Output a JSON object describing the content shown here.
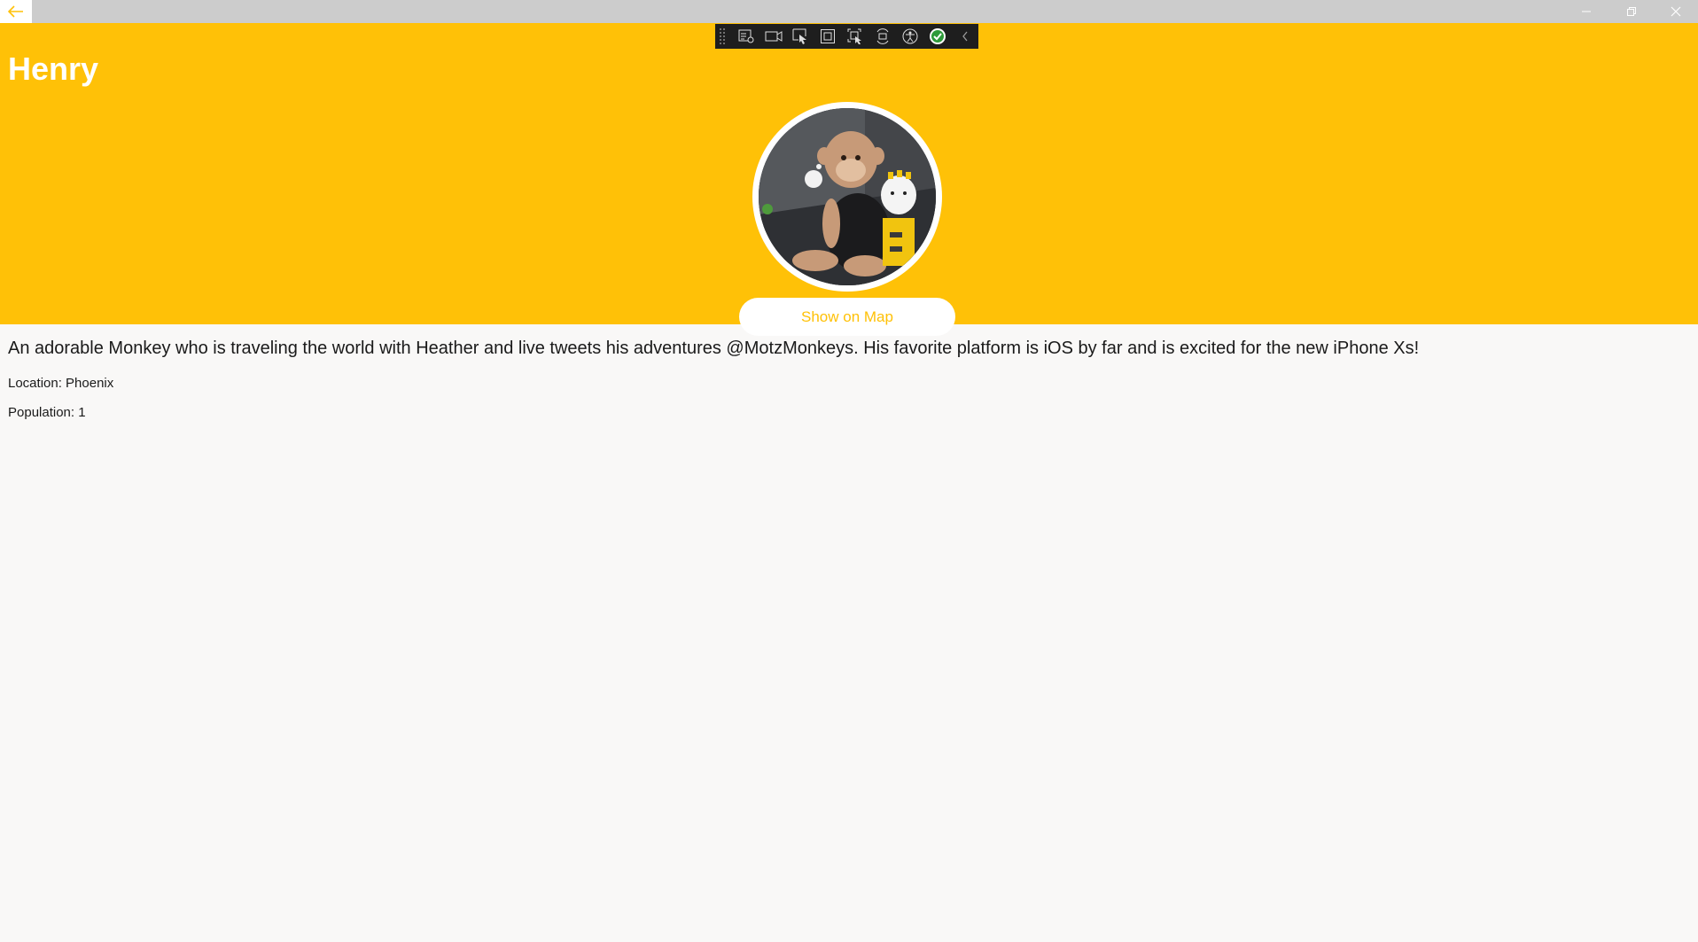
{
  "window": {
    "back_icon": "arrow-left-icon",
    "minimize_icon": "minimize-icon",
    "restore_icon": "restore-icon",
    "close_icon": "close-icon"
  },
  "devtools": {
    "tools": [
      "live-visual-tree-icon",
      "video-record-icon",
      "select-element-icon",
      "display-layout-adorners-icon",
      "track-focused-element-icon",
      "hot-reload-icon",
      "accessibility-checker-icon",
      "binding-status-ok-icon",
      "collapse-toolbar-icon"
    ]
  },
  "header": {
    "title": "Henry",
    "background_color": "#ffc107",
    "avatar_icon": "monkey-photo",
    "map_button_label": "Show on Map"
  },
  "details": {
    "description": "An adorable Monkey who is traveling the world with Heather and live tweets his adventures @MotzMonkeys. His favorite platform is iOS by far and is excited for the new iPhone Xs!",
    "location": "Location: Phoenix",
    "population": "Population: 1"
  }
}
